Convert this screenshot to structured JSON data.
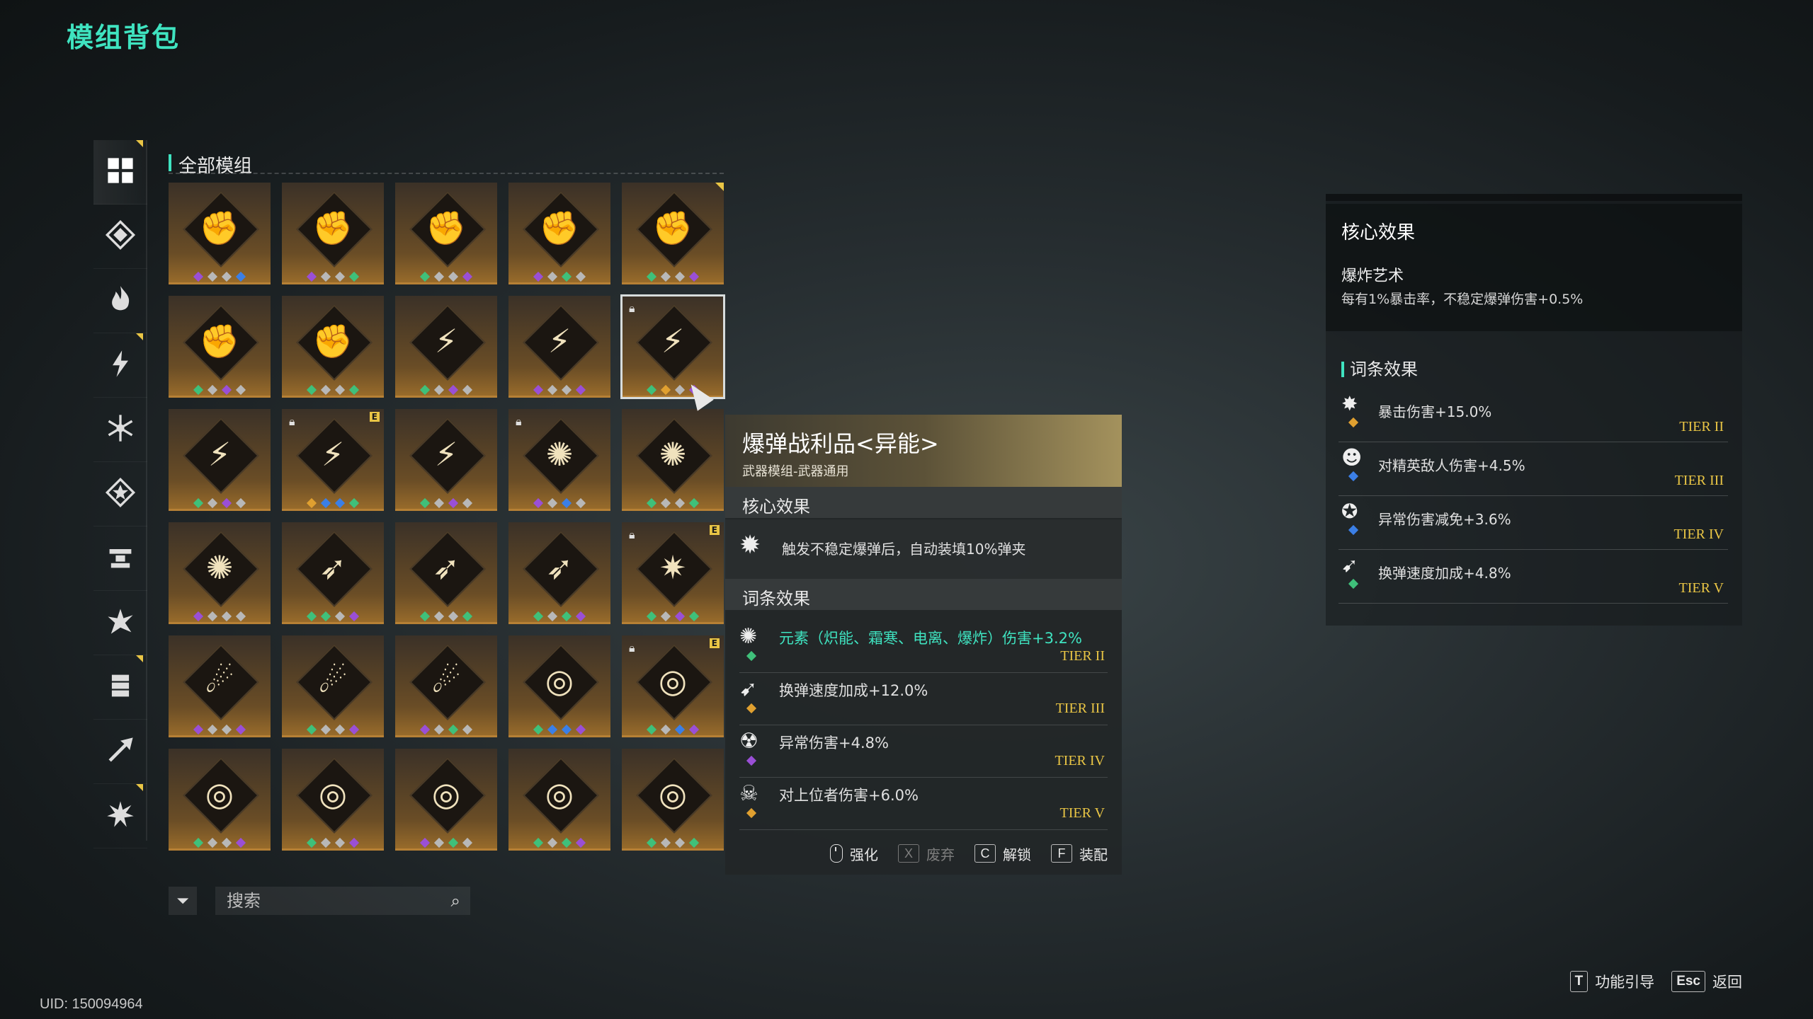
{
  "page_title": "模组背包",
  "uid": "UID: 150094964",
  "sidebar": {
    "items": [
      {
        "icon": "grid-icon",
        "active": true
      },
      {
        "icon": "diamond-icon",
        "active": false
      },
      {
        "icon": "fire-icon",
        "active": false
      },
      {
        "icon": "lightning-icon",
        "active": false
      },
      {
        "icon": "snowflake-icon",
        "active": false
      },
      {
        "icon": "star-emblem-icon",
        "active": false
      },
      {
        "icon": "anvil-icon",
        "active": false
      },
      {
        "icon": "burst-icon",
        "active": false
      },
      {
        "icon": "ammo-icon",
        "active": false
      },
      {
        "icon": "arrow-icon",
        "active": false
      },
      {
        "icon": "explosion-icon",
        "active": false
      }
    ]
  },
  "grid": {
    "section_label": "全部模组",
    "gem_colors": {
      "green": "#3fc07a",
      "purple": "#9a4fd6",
      "blue": "#3b7fe6",
      "gray": "#b8b8b8",
      "orange": "#e0a030"
    },
    "tiles": [
      {
        "glyph": "✊",
        "dots": [
          "purple",
          "gray",
          "gray",
          "blue"
        ]
      },
      {
        "glyph": "✊",
        "dots": [
          "purple",
          "gray",
          "gray",
          "green"
        ]
      },
      {
        "glyph": "✊",
        "dots": [
          "green",
          "gray",
          "gray",
          "purple"
        ]
      },
      {
        "glyph": "✊",
        "dots": [
          "purple",
          "gray",
          "green",
          "gray"
        ]
      },
      {
        "glyph": "✊",
        "dots": [
          "green",
          "gray",
          "gray",
          "purple"
        ],
        "corner": true
      },
      {
        "glyph": "✊",
        "dots": [
          "green",
          "gray",
          "purple",
          "gray"
        ]
      },
      {
        "glyph": "✊",
        "dots": [
          "green",
          "gray",
          "gray",
          "green"
        ]
      },
      {
        "glyph": "⚡",
        "dots": [
          "green",
          "gray",
          "purple",
          "gray"
        ]
      },
      {
        "glyph": "⚡",
        "dots": [
          "purple",
          "gray",
          "gray",
          "purple"
        ]
      },
      {
        "glyph": "⚡",
        "dots": [
          "green",
          "orange",
          "gray",
          "purple"
        ],
        "lock": true,
        "selected": true
      },
      {
        "glyph": "⚡",
        "dots": [
          "green",
          "gray",
          "purple",
          "gray"
        ]
      },
      {
        "glyph": "⚡",
        "dots": [
          "orange",
          "blue",
          "blue",
          "green"
        ],
        "lock": true,
        "ebadge": true
      },
      {
        "glyph": "⚡",
        "dots": [
          "green",
          "gray",
          "purple",
          "gray"
        ]
      },
      {
        "glyph": "✺",
        "dots": [
          "purple",
          "gray",
          "blue",
          "gray"
        ],
        "lock": true
      },
      {
        "glyph": "✺",
        "dots": [
          "green",
          "gray",
          "gray",
          "green"
        ]
      },
      {
        "glyph": "✺",
        "dots": [
          "purple",
          "gray",
          "gray",
          "gray"
        ]
      },
      {
        "glyph": "➶",
        "dots": [
          "green",
          "green",
          "gray",
          "purple"
        ]
      },
      {
        "glyph": "➶",
        "dots": [
          "green",
          "gray",
          "gray",
          "green"
        ]
      },
      {
        "glyph": "➶",
        "dots": [
          "green",
          "gray",
          "green",
          "purple"
        ]
      },
      {
        "glyph": "✷",
        "dots": [
          "green",
          "gray",
          "purple",
          "green"
        ],
        "lock": true,
        "ebadge": true
      },
      {
        "glyph": "☄",
        "dots": [
          "purple",
          "gray",
          "gray",
          "purple"
        ]
      },
      {
        "glyph": "☄",
        "dots": [
          "green",
          "gray",
          "gray",
          "purple"
        ]
      },
      {
        "glyph": "☄",
        "dots": [
          "purple",
          "gray",
          "green",
          "gray"
        ]
      },
      {
        "glyph": "◎",
        "dots": [
          "green",
          "blue",
          "blue",
          "purple"
        ]
      },
      {
        "glyph": "◎",
        "dots": [
          "green",
          "gray",
          "blue",
          "purple"
        ],
        "lock": true,
        "ebadge": true
      },
      {
        "glyph": "◎",
        "dots": [
          "green",
          "gray",
          "gray",
          "purple"
        ]
      },
      {
        "glyph": "◎",
        "dots": [
          "green",
          "gray",
          "gray",
          "purple"
        ]
      },
      {
        "glyph": "◎",
        "dots": [
          "purple",
          "gray",
          "green",
          "gray"
        ]
      },
      {
        "glyph": "◎",
        "dots": [
          "green",
          "gray",
          "green",
          "purple"
        ]
      },
      {
        "glyph": "◎",
        "dots": [
          "green",
          "gray",
          "gray",
          "green"
        ]
      }
    ]
  },
  "search": {
    "placeholder": "搜索"
  },
  "tooltip": {
    "title": "爆弹战利品<异能>",
    "subtitle": "武器模组-武器通用",
    "core_label": "核心效果",
    "core_text": "触发不稳定爆弹后，自动装填10%弹夹",
    "affix_label": "词条效果",
    "affixes": [
      {
        "icon": "flame-atom-icon",
        "gem": "green",
        "text": "元素（炽能、霜寒、电离、爆炸）伤害+3.2%",
        "tier": "TIER II",
        "highlight": true
      },
      {
        "icon": "reload-icon",
        "gem": "orange",
        "text": "换弹速度加成+12.0%",
        "tier": "TIER III",
        "highlight": false
      },
      {
        "icon": "anomaly-icon",
        "gem": "purple",
        "text": "异常伤害+4.8%",
        "tier": "TIER IV",
        "highlight": false
      },
      {
        "icon": "skull-icon",
        "gem": "orange",
        "text": "对上位者伤害+6.0%",
        "tier": "TIER V",
        "highlight": false
      }
    ],
    "actions": [
      {
        "key": "mouse",
        "label": "强化",
        "enabled": true
      },
      {
        "key": "X",
        "label": "废弃",
        "enabled": false
      },
      {
        "key": "C",
        "label": "解锁",
        "enabled": true
      },
      {
        "key": "F",
        "label": "装配",
        "enabled": true
      }
    ]
  },
  "right_panel": {
    "core_label": "核心效果",
    "core_name": "爆炸艺术",
    "core_desc": "每有1%暴击率，不稳定爆弹伤害+0.5%",
    "affix_label": "词条效果",
    "affixes": [
      {
        "icon": "crit-icon",
        "gem": "orange",
        "text": "暴击伤害+15.0%",
        "tier": "TIER II"
      },
      {
        "icon": "elite-icon",
        "gem": "blue",
        "text": "对精英敌人伤害+4.5%",
        "tier": "TIER III"
      },
      {
        "icon": "shield-star-icon",
        "gem": "blue",
        "text": "异常伤害减免+3.6%",
        "tier": "TIER IV"
      },
      {
        "icon": "reload-icon",
        "gem": "green",
        "text": "换弹速度加成+4.8%",
        "tier": "TIER V"
      }
    ]
  },
  "hints": [
    {
      "key": "T",
      "label": "功能引导"
    },
    {
      "key": "Esc",
      "label": "返回"
    }
  ]
}
